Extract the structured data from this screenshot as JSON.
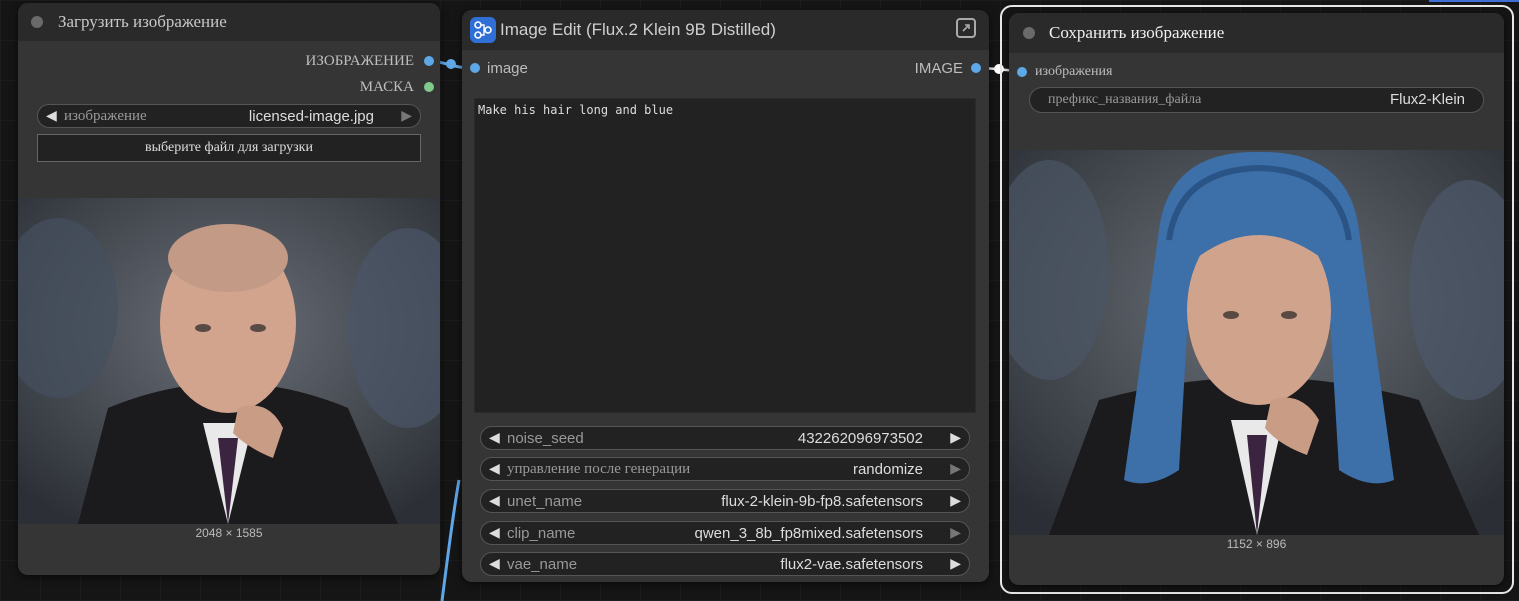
{
  "load_node": {
    "title": "Загрузить изображение",
    "outputs": [
      "ИЗОБРАЖЕНИЕ",
      "МАСКА"
    ],
    "image_widget": {
      "label": "изображение",
      "value": "licensed-image.jpg"
    },
    "upload_button": "выберите файл для загрузки",
    "image_size": "2048 × 1585"
  },
  "edit_node": {
    "title": "Image Edit (Flux.2 Klein 9B Distilled)",
    "input": "image",
    "output": "IMAGE",
    "prompt": "Make his hair long and blue",
    "widgets": [
      {
        "label": "noise_seed",
        "value": "432262096973502"
      },
      {
        "label": "управление после генерации",
        "value": "randomize"
      },
      {
        "label": "unet_name",
        "value": "flux-2-klein-9b-fp8.safetensors"
      },
      {
        "label": "clip_name",
        "value": "qwen_3_8b_fp8mixed.safetensors"
      },
      {
        "label": "vae_name",
        "value": "flux2-vae.safetensors"
      }
    ]
  },
  "save_node": {
    "title": "Сохранить изображение",
    "input": "изображения",
    "prefix_widget": {
      "label": "префикс_названия_файла",
      "value": "Flux2-Klein"
    },
    "image_size": "1152 × 896"
  },
  "colors": {
    "image_slot": "#5fa8e8",
    "mask_slot": "#7fc98a",
    "canvas": "#151515",
    "node_body": "#353535",
    "node_header": "#2a2a2a",
    "subgraph_badge": "#2f6fd6"
  }
}
